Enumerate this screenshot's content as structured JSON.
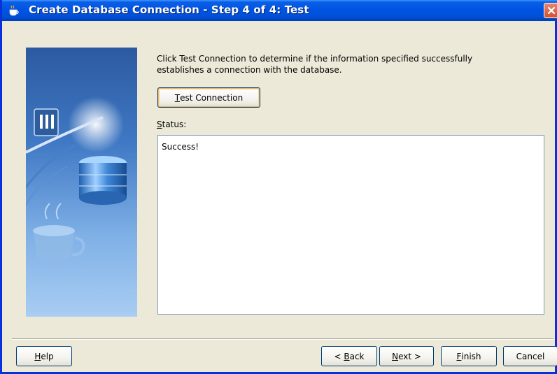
{
  "window": {
    "title": "Create Database Connection - Step 4 of 4: Test",
    "title_icon": "coffee-cup-icon",
    "close_icon": "close-icon"
  },
  "content": {
    "instructions": "Click Test Connection to determine if the information specified successfully establishes a connection with the database.",
    "test_button": {
      "mnemonic": "T",
      "rest": "est Connection"
    },
    "status_label": {
      "mnemonic": "S",
      "rest": "tatus:"
    },
    "status_text": "Success!"
  },
  "footer": {
    "help": {
      "mnemonic": "H",
      "rest": "elp"
    },
    "back": {
      "prefix": "< ",
      "mnemonic": "B",
      "rest": "ack"
    },
    "next": {
      "mnemonic": "N",
      "rest": "ext >"
    },
    "finish": {
      "mnemonic": "F",
      "rest": "inish"
    },
    "cancel": "Cancel"
  },
  "colors": {
    "titlebar": "#0054e3",
    "dialog_bg": "#ece9d8",
    "close_button": "#d0522f",
    "default_button_ring": "#e8b56a"
  }
}
